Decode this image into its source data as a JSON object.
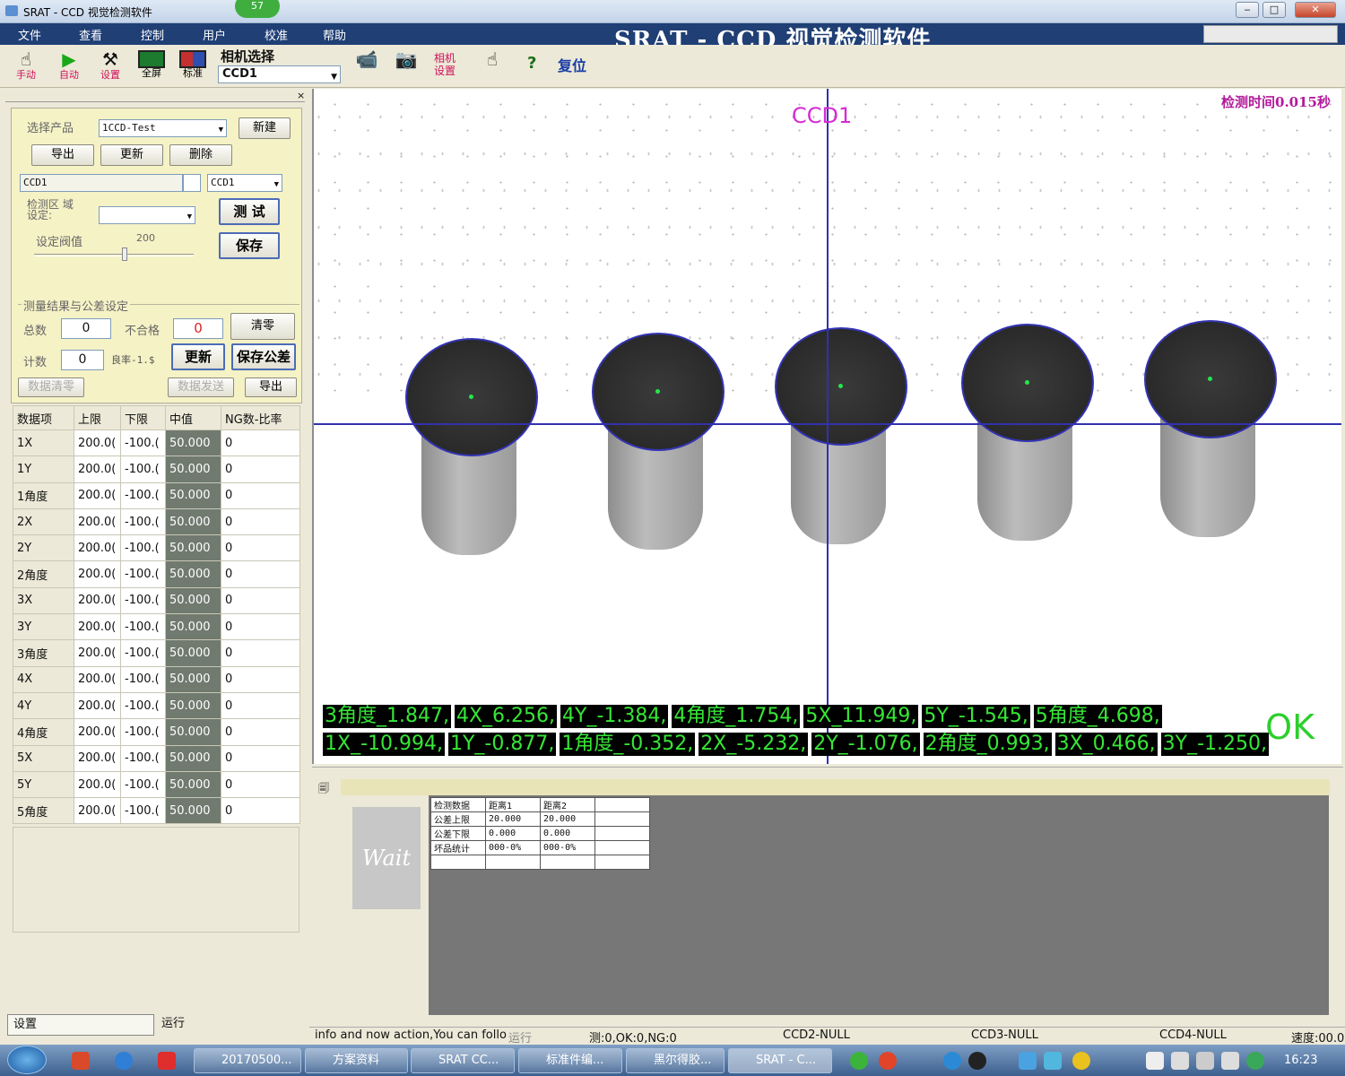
{
  "window": {
    "title": "SRAT - CCD 视觉检测软件",
    "badge": "57",
    "big_title": "SRAT - CCD 视觉检测软件"
  },
  "menu": [
    "文件",
    "查看",
    "控制",
    "用户",
    "校准",
    "帮助"
  ],
  "toolbar": {
    "manual": "手动",
    "auto": "自动",
    "settings": "设置",
    "fullscreen": "全屏",
    "standard": "标准",
    "camera_select_label": "相机选择",
    "camera_select_value": "CCD1",
    "camera_settings": "相机设置",
    "help": "?",
    "reset": "复位"
  },
  "config": {
    "product_label": "选择产品",
    "product_value": "1CCD-Test",
    "new_btn": "新建",
    "export_btn": "导出",
    "update_btn": "更新",
    "delete_btn": "删除",
    "ccd_field": "CCD1",
    "ccd_select": "CCD1",
    "region_label": "检测区 域设定:",
    "test_btn": "测 试",
    "threshold_label": "设定阀值",
    "threshold_value": "200",
    "threshold_fraction": 0.55,
    "save_btn": "保存",
    "group_label": "测量结果与公差设定",
    "total_label": "总数",
    "total_value": "0",
    "ng_label": "不合格",
    "ng_value": "0",
    "clear_btn": "清零",
    "count_label": "计数",
    "count_value": "0",
    "yield_label": "良率-1.$",
    "update2_btn": "更新",
    "save_tol_btn": "保存公差",
    "data_clear_btn": "数据清零",
    "data_send_btn": "数据发送",
    "export2_btn": "导出"
  },
  "table": {
    "headers": [
      "数据项",
      "上限",
      "下限",
      "中值",
      "NG数-比率"
    ],
    "rows": [
      [
        "1X",
        "200.0(",
        "-100.(",
        "50.000",
        "0"
      ],
      [
        "1Y",
        "200.0(",
        "-100.(",
        "50.000",
        "0"
      ],
      [
        "1角度",
        "200.0(",
        "-100.(",
        "50.000",
        "0"
      ],
      [
        "2X",
        "200.0(",
        "-100.(",
        "50.000",
        "0"
      ],
      [
        "2Y",
        "200.0(",
        "-100.(",
        "50.000",
        "0"
      ],
      [
        "2角度",
        "200.0(",
        "-100.(",
        "50.000",
        "0"
      ],
      [
        "3X",
        "200.0(",
        "-100.(",
        "50.000",
        "0"
      ],
      [
        "3Y",
        "200.0(",
        "-100.(",
        "50.000",
        "0"
      ],
      [
        "3角度",
        "200.0(",
        "-100.(",
        "50.000",
        "0"
      ],
      [
        "4X",
        "200.0(",
        "-100.(",
        "50.000",
        "0"
      ],
      [
        "4Y",
        "200.0(",
        "-100.(",
        "50.000",
        "0"
      ],
      [
        "4角度",
        "200.0(",
        "-100.(",
        "50.000",
        "0"
      ],
      [
        "5X",
        "200.0(",
        "-100.(",
        "50.000",
        "0"
      ],
      [
        "5Y",
        "200.0(",
        "-100.(",
        "50.000",
        "0"
      ],
      [
        "5角度",
        "200.0(",
        "-100.(",
        "50.000",
        "0"
      ]
    ]
  },
  "left_tabs": {
    "settings": "设置",
    "run": "运行"
  },
  "viewer": {
    "camera_label": "CCD1",
    "detect_time": "检测时间0.015秒",
    "row1": [
      "3角度_1.847,",
      "4X_6.256,",
      "4Y_-1.384,",
      "4角度_1.754,",
      "5X_11.949,",
      "5Y_-1.545,",
      "5角度_4.698,"
    ],
    "row2": [
      "1X_-10.994,",
      "1Y_-0.877,",
      "1角度_-0.352,",
      "2X_-5.232,",
      "2Y_-1.076,",
      "2角度_0.993,",
      "3X_0.466,",
      "3Y_-1.250,"
    ],
    "result": "OK"
  },
  "lower": {
    "wait": "Wait",
    "grid": [
      [
        "检测数据",
        "距离1",
        "距离2",
        ""
      ],
      [
        "公差上限",
        "20.000",
        "20.000",
        ""
      ],
      [
        "公差下限",
        "0.000",
        "0.000",
        ""
      ],
      [
        "坏品统计",
        "000-0%",
        "000-0%",
        ""
      ],
      [
        "",
        "",
        "",
        ""
      ]
    ]
  },
  "status": {
    "info": "info and now action,You can follo",
    "run": "运行",
    "counts": "测:0,OK:0,NG:0",
    "ccd2": "CCD2-NULL",
    "ccd3": "CCD3-NULL",
    "ccd4": "CCD4-NULL",
    "speed": "速度:00.0"
  },
  "taskbar": {
    "items": [
      "20170500...",
      "方案资料",
      "SRAT CC...",
      "标准件编...",
      "黑尔得胶...",
      "SRAT - C..."
    ],
    "clock": "16:23"
  }
}
